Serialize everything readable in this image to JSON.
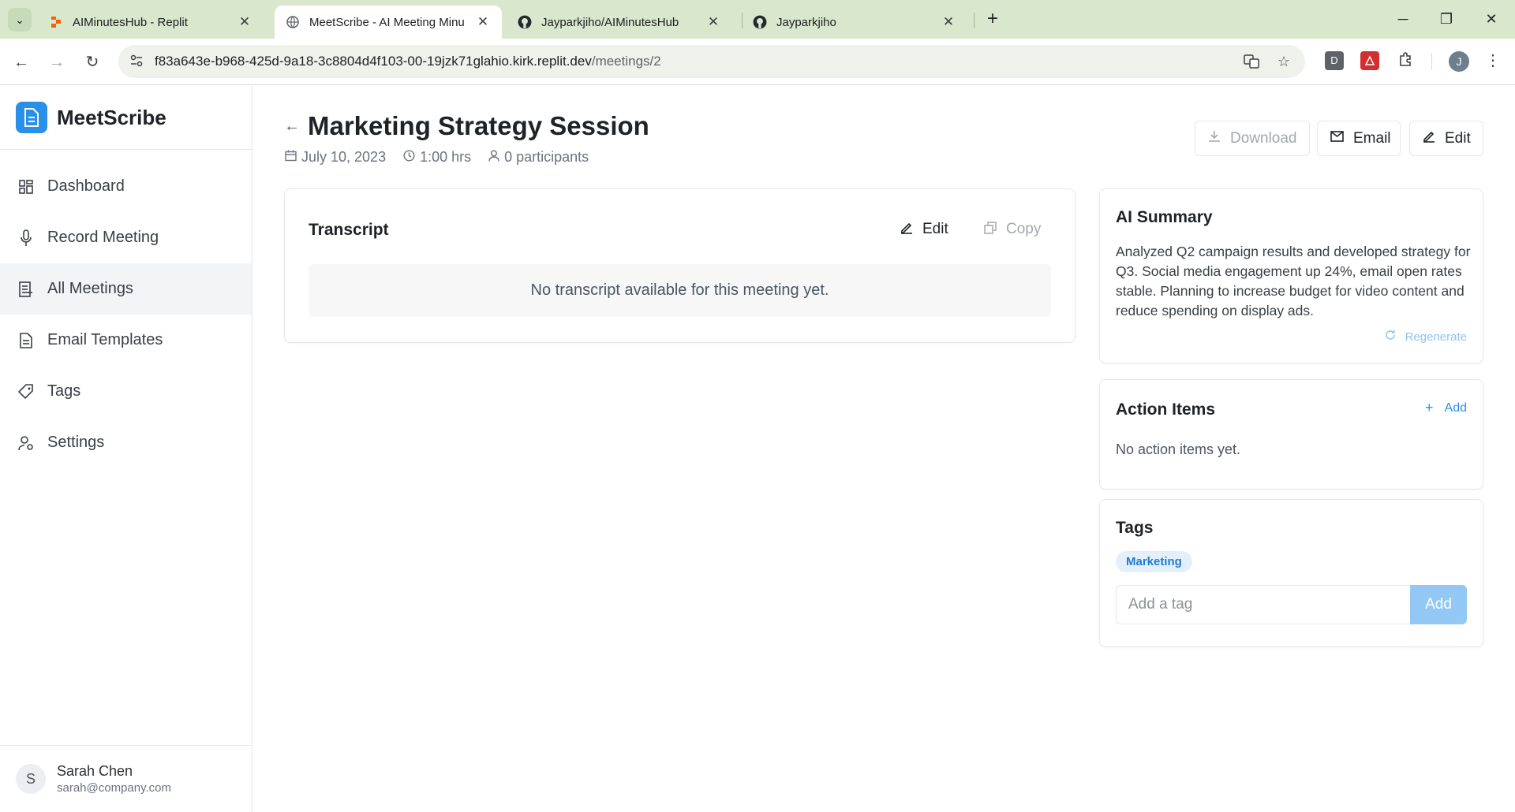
{
  "browser": {
    "tabs": [
      {
        "title": "AIMinutesHub - Replit"
      },
      {
        "title": "MeetScribe - AI Meeting Minu"
      },
      {
        "title": "Jayparkjiho/AIMinutesHub"
      },
      {
        "title": "Jayparkjiho"
      }
    ],
    "url_host": "f83a643e-b968-425d-9a18-3c8804d4f103-00-19jzk71glahio.kirk.replit.dev",
    "url_path": "/meetings/2",
    "profile_initial": "J",
    "ext_d_label": "D"
  },
  "app": {
    "brand": "MeetScribe",
    "nav": [
      {
        "label": "Dashboard",
        "icon": "dashboard-icon"
      },
      {
        "label": "Record Meeting",
        "icon": "microphone-icon"
      },
      {
        "label": "All Meetings",
        "icon": "list-icon",
        "active": true
      },
      {
        "label": "Email Templates",
        "icon": "document-icon"
      },
      {
        "label": "Tags",
        "icon": "tag-icon"
      },
      {
        "label": "Settings",
        "icon": "user-settings-icon"
      }
    ],
    "user": {
      "initial": "S",
      "name": "Sarah Chen",
      "email": "sarah@company.com"
    }
  },
  "meeting": {
    "title": "Marketing Strategy Session",
    "date": "July 10, 2023",
    "duration": "1:00 hrs",
    "participants": "0 participants"
  },
  "header_buttons": {
    "download": "Download",
    "email": "Email",
    "edit": "Edit"
  },
  "transcript": {
    "heading": "Transcript",
    "edit_label": "Edit",
    "copy_label": "Copy",
    "empty": "No transcript available for this meeting yet."
  },
  "summary": {
    "heading": "AI Summary",
    "text": "Analyzed Q2 campaign results and developed strategy for Q3. Social media engagement up 24%, email open rates stable. Planning to increase budget for video content and reduce spending on display ads.",
    "regenerate": "Regenerate"
  },
  "action_items": {
    "heading": "Action Items",
    "add_label": "Add",
    "empty": "No action items yet."
  },
  "tags": {
    "heading": "Tags",
    "items": [
      "Marketing"
    ],
    "input_placeholder": "Add a tag",
    "add_label": "Add"
  },
  "colors": {
    "accent": "#2b8fe8",
    "tab_bar": "#d9e7cd",
    "tag_bg": "#e3f0fc"
  }
}
